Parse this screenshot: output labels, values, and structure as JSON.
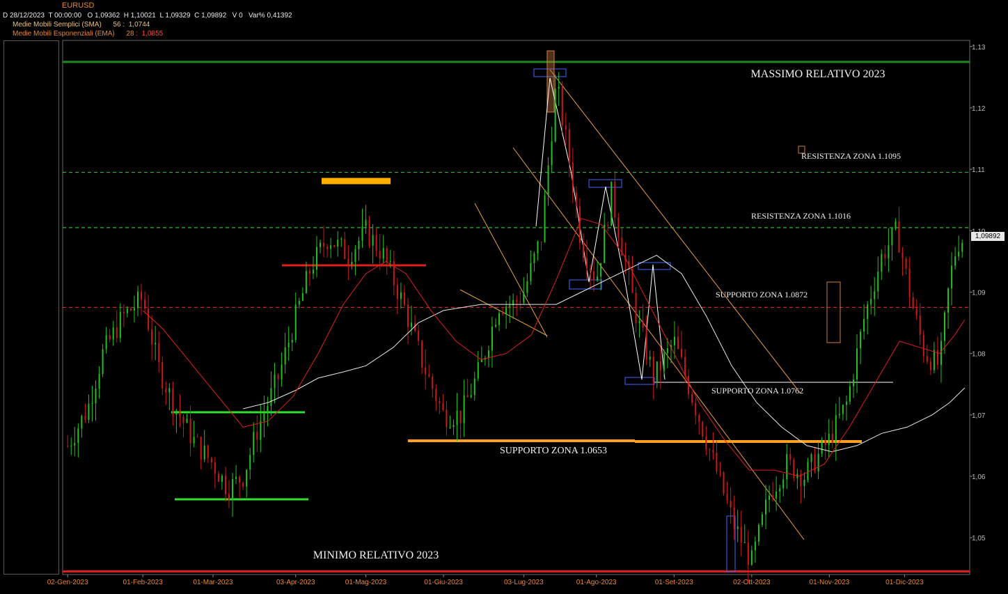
{
  "header": {
    "symbol": "EURUSD",
    "date": "D 28/12/2023",
    "time": "T 00:00:00",
    "open": "O 1,09362",
    "high": "H 1,10021",
    "low": "L 1,09329",
    "close": "C 1,09892",
    "volume": "V 0",
    "var_pct": "Var% 0,41392",
    "sma": {
      "label": "Medie Mobili Semplici (SMA)",
      "period": "56 :",
      "value": "1,0744"
    },
    "ema": {
      "label": "Medie Mobili Esponenziali (EMA)",
      "period": "28 :",
      "value": "1,0855"
    }
  },
  "last_price": "1,09892",
  "chart_data": {
    "type": "line",
    "title": "EURUSD",
    "ylim": [
      1.044,
      1.131
    ],
    "y_ticks": [
      "1,13",
      "1,12",
      "1,11",
      "1,10",
      "1,09",
      "1,08",
      "1,07",
      "1,06",
      "1,05"
    ],
    "y_tick_values": [
      1.13,
      1.12,
      1.11,
      1.1,
      1.09,
      1.08,
      1.07,
      1.06,
      1.05
    ],
    "x_ticks": [
      "02-Gen-2023",
      "01-Feb-2023",
      "01-Mar-2023",
      "03-Apr-2023",
      "01-Mag-2023",
      "01-Giu-2023",
      "03-Lug-2023",
      "01-Ago-2023",
      "01-Set-2023",
      "02-Ott-2023",
      "01-Nov-2023",
      "01-Dic-2023"
    ],
    "x_tick_days": [
      0,
      30,
      58,
      91,
      119,
      150,
      182,
      211,
      242,
      273,
      304,
      334
    ],
    "x_range_days": [
      -2,
      360
    ],
    "grid": false,
    "series": [
      {
        "name": "EURUSD",
        "color_up": "#22c222",
        "color_down": "#cc1a1a",
        "x_days": [
          0,
          8,
          14,
          22,
          30,
          36,
          42,
          50,
          58,
          64,
          70,
          76,
          84,
          91,
          97,
          104,
          112,
          119,
          126,
          134,
          142,
          150,
          157,
          165,
          172,
          178,
          182,
          189,
          195,
          200,
          205,
          211,
          217,
          222,
          227,
          234,
          242,
          250,
          258,
          266,
          273,
          280,
          287,
          294,
          304,
          311,
          318,
          325,
          331,
          337,
          342,
          348,
          352,
          355,
          358
        ],
        "values": [
          1.065,
          1.071,
          1.08,
          1.086,
          1.089,
          1.078,
          1.072,
          1.066,
          1.062,
          1.058,
          1.06,
          1.068,
          1.076,
          1.086,
          1.094,
          1.099,
          1.096,
          1.1,
          1.096,
          1.088,
          1.078,
          1.07,
          1.07,
          1.078,
          1.088,
          1.088,
          1.09,
          1.099,
          1.124,
          1.112,
          1.098,
          1.092,
          1.106,
          1.096,
          1.086,
          1.076,
          1.082,
          1.072,
          1.062,
          1.052,
          1.046,
          1.057,
          1.062,
          1.06,
          1.066,
          1.072,
          1.086,
          1.096,
          1.1,
          1.088,
          1.08,
          1.078,
          1.092,
          1.098,
          1.0989
        ]
      },
      {
        "name": "Medie Mobili Semplici (SMA) 56",
        "color": "#e8e8e8",
        "x_days": [
          70,
          80,
          91,
          100,
          110,
          119,
          130,
          140,
          150,
          165,
          180,
          195,
          205,
          215,
          225,
          235,
          245,
          255,
          265,
          275,
          285,
          295,
          305,
          315,
          325,
          335,
          345,
          352,
          358
        ],
        "values": [
          1.071,
          1.072,
          1.074,
          1.076,
          1.077,
          1.078,
          1.081,
          1.085,
          1.087,
          1.088,
          1.088,
          1.088,
          1.09,
          1.092,
          1.094,
          1.096,
          1.093,
          1.086,
          1.078,
          1.072,
          1.068,
          1.065,
          1.064,
          1.065,
          1.067,
          1.068,
          1.07,
          1.072,
          1.0744
        ]
      },
      {
        "name": "Medie Mobili Esponenziali (EMA) 28",
        "color": "#dd2020",
        "x_days": [
          30,
          38,
          46,
          54,
          62,
          70,
          80,
          90,
          100,
          110,
          119,
          127,
          135,
          145,
          155,
          165,
          175,
          185,
          195,
          205,
          213,
          222,
          232,
          242,
          252,
          262,
          272,
          282,
          292,
          302,
          312,
          322,
          332,
          340,
          348,
          354,
          358
        ],
        "values": [
          1.087,
          1.084,
          1.08,
          1.076,
          1.072,
          1.068,
          1.069,
          1.073,
          1.08,
          1.088,
          1.093,
          1.095,
          1.093,
          1.087,
          1.082,
          1.079,
          1.08,
          1.083,
          1.092,
          1.102,
          1.101,
          1.096,
          1.088,
          1.08,
          1.072,
          1.066,
          1.061,
          1.061,
          1.06,
          1.062,
          1.068,
          1.075,
          1.082,
          1.081,
          1.08,
          1.083,
          1.0855
        ]
      }
    ],
    "levels": [
      {
        "name": "MASSIMO RELATIVO 2023",
        "label": "MASSIMO RELATIVO 2023",
        "value": 1.1275,
        "color": "#1f8a1f",
        "style": "solid"
      },
      {
        "name": "RESISTENZA ZONA 1.1095",
        "label": "RESISTENZA ZONA 1.1095",
        "value": 1.1095,
        "color": "#2eb82e",
        "style": "dashed"
      },
      {
        "name": "RESISTENZA ZONA 1.1016",
        "label": "RESISTENZA ZONA 1.1016",
        "value": 1.1005,
        "color": "#2eb82e",
        "style": "dashed"
      },
      {
        "name": "SUPPORTO ZONA 1.0872",
        "label": "SUPPORTO ZONA 1.0872",
        "value": 1.0875,
        "color": "#cc2a2a",
        "style": "dashed"
      },
      {
        "name": "MINIMO RELATIVO 2023",
        "label": "MINIMO RELATIVO 2023",
        "value": 1.0445,
        "color": "#e02020",
        "style": "solid"
      }
    ],
    "annotations": [
      {
        "label": "SUPPORTO ZONA 1.0653",
        "value": 1.0653
      },
      {
        "label": "SUPPORTO ZONA 1.0762",
        "value": 1.0755
      }
    ]
  }
}
